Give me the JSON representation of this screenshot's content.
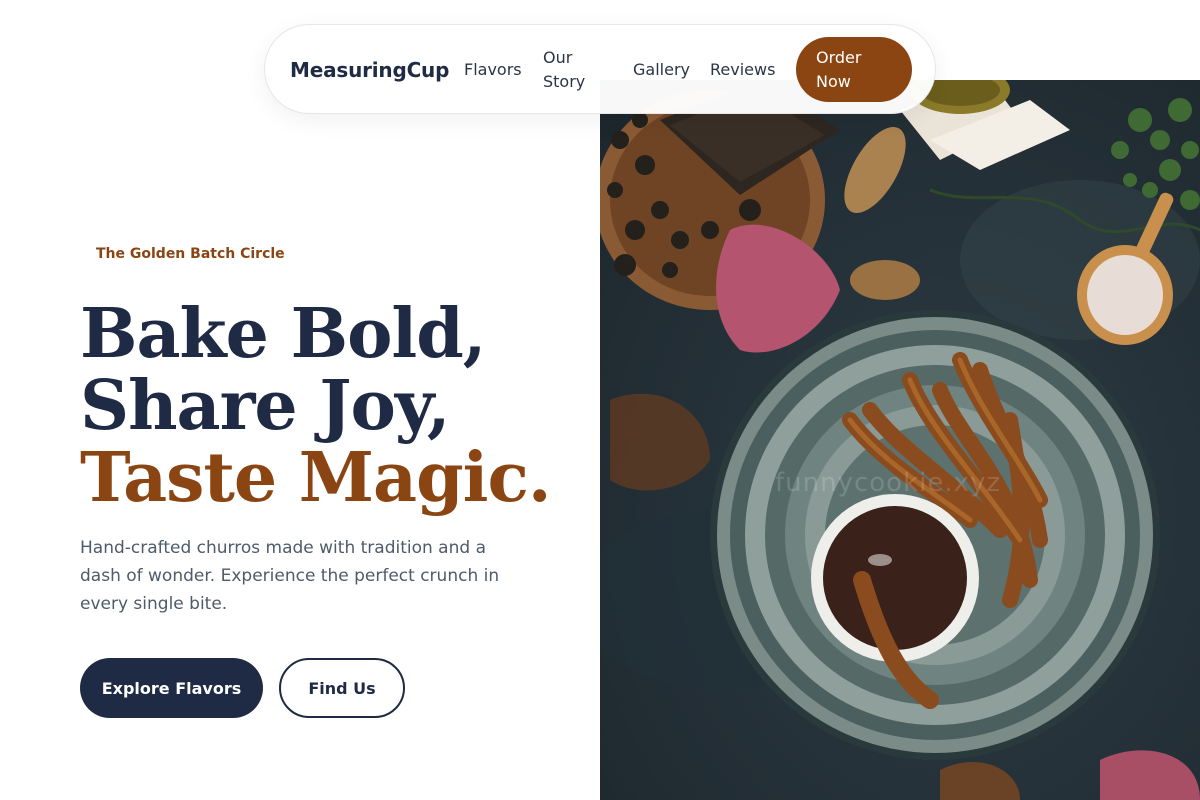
{
  "nav": {
    "brand": "MeasuringCup",
    "links": [
      "Flavors",
      "Our Story",
      "Gallery",
      "Reviews"
    ],
    "cta": "Order Now"
  },
  "hero": {
    "kicker": "The Golden Batch Circle",
    "headline_line1": "Bake Bold,",
    "headline_line2": "Share Joy,",
    "headline_line3": "Taste Magic.",
    "description": "Hand-crafted churros made with tradition and a dash of wonder. Experience the perfect crunch in every single bite.",
    "primary_button": "Explore Flavors",
    "secondary_button": "Find Us"
  },
  "image": {
    "watermark": "funnycookie.xyz"
  },
  "colors": {
    "primary": "#1f2a44",
    "accent": "#8b4513",
    "text_muted": "#4f5a6b",
    "background": "#ffffff"
  },
  "icons": [
    "churros-photo"
  ]
}
